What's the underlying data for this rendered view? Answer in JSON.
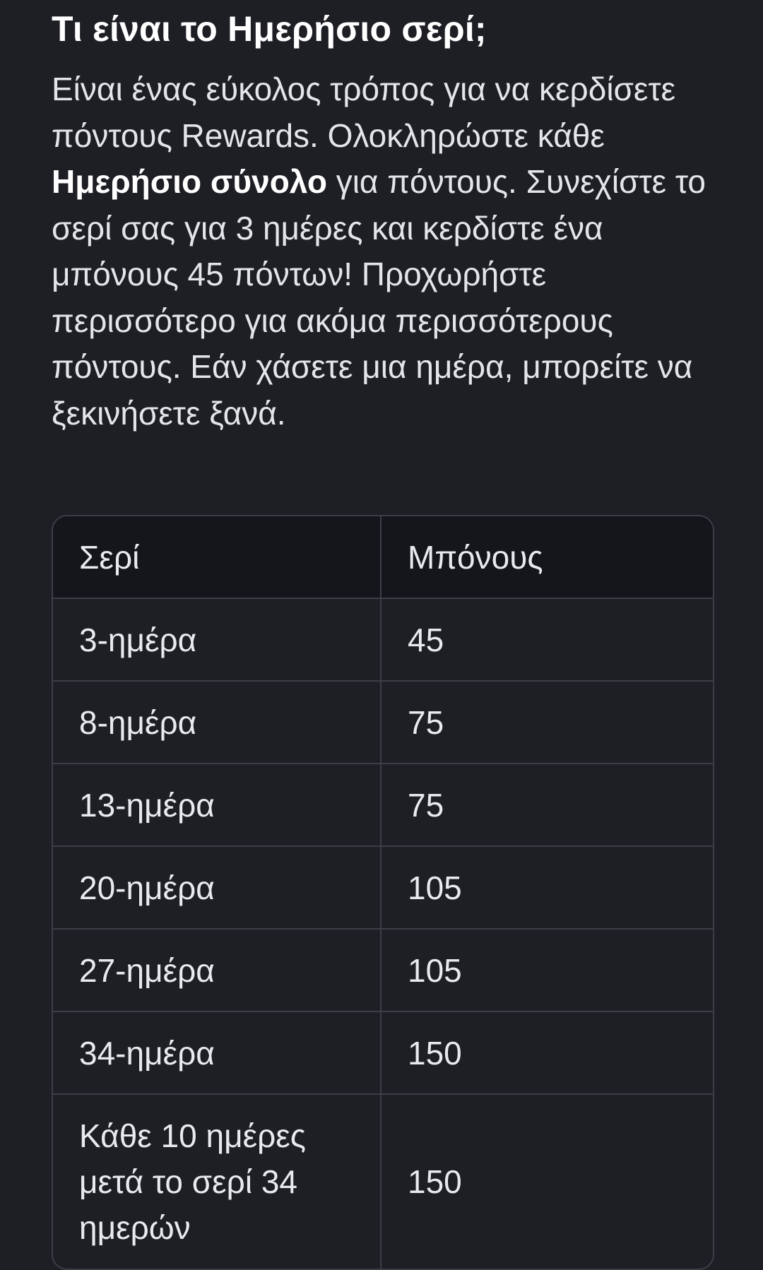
{
  "heading": "Τι είναι το Ημερήσιο σερί;",
  "intro": {
    "part1": "Είναι ένας εύκολος τρόπος για να κερδίσετε πόντους Rewards. Ολοκληρώστε κάθε ",
    "bold": "Ημερήσιο σύνολο",
    "part2": " για πόντους. Συνεχίστε το σερί σας για 3 ημέρες και κερδίστε ένα μπόνους 45 πόντων! Προχωρήστε περισσότερο για ακόμα περισσότερους πόντους. Εάν χάσετε μια ημέρα, μπορείτε να ξεκινήσετε ξανά."
  },
  "table": {
    "headers": [
      "Σερί",
      "Μπόνους"
    ],
    "rows": [
      {
        "streak": "3-ημέρα",
        "bonus": "45"
      },
      {
        "streak": "8-ημέρα",
        "bonus": "75"
      },
      {
        "streak": "13-ημέρα",
        "bonus": "75"
      },
      {
        "streak": "20-ημέρα",
        "bonus": "105"
      },
      {
        "streak": "27-ημέρα",
        "bonus": "105"
      },
      {
        "streak": "34-ημέρα",
        "bonus": "150"
      },
      {
        "streak": "Κάθε 10 ημέρες μετά το σερί 34 ημερών",
        "bonus": "150"
      }
    ]
  }
}
